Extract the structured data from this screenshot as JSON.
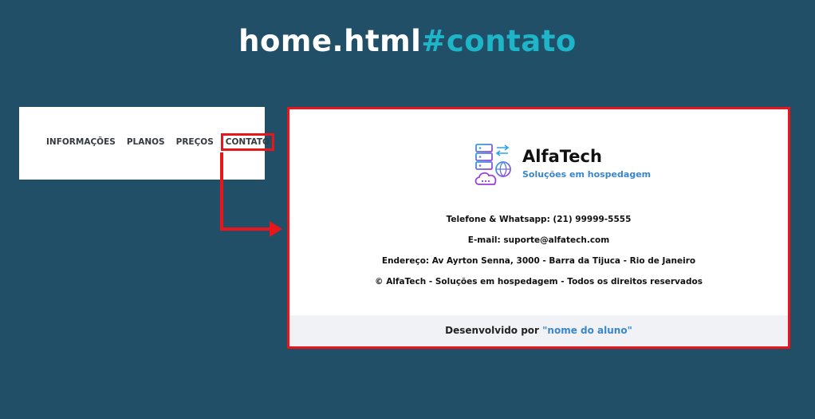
{
  "title": {
    "main": "home.html",
    "anchor": "#contato"
  },
  "nav": {
    "items": [
      {
        "label": "INFORMAÇÕES"
      },
      {
        "label": "PLANOS"
      },
      {
        "label": "PREÇOS"
      },
      {
        "label": "CONTATO"
      }
    ]
  },
  "footer": {
    "brand_name": "AlfaTech",
    "brand_tagline": "Soluções em hospedagem",
    "phone": "Telefone & Whatsapp: (21) 99999-5555",
    "email": "E-mail: suporte@alfatech.com",
    "address": "Endereço: Av Ayrton Senna, 3000 - Barra da Tijuca - Rio de Janeiro",
    "copyright": "© AlfaTech - Soluções em hospedagem - Todos os direitos reservados",
    "dev_prefix": "Desenvolvido por",
    "dev_name": "\"nome do aluno\""
  },
  "colors": {
    "background": "#214f68",
    "accent": "#1fb5c9",
    "highlight": "#e8151b",
    "link": "#3a86c8"
  }
}
